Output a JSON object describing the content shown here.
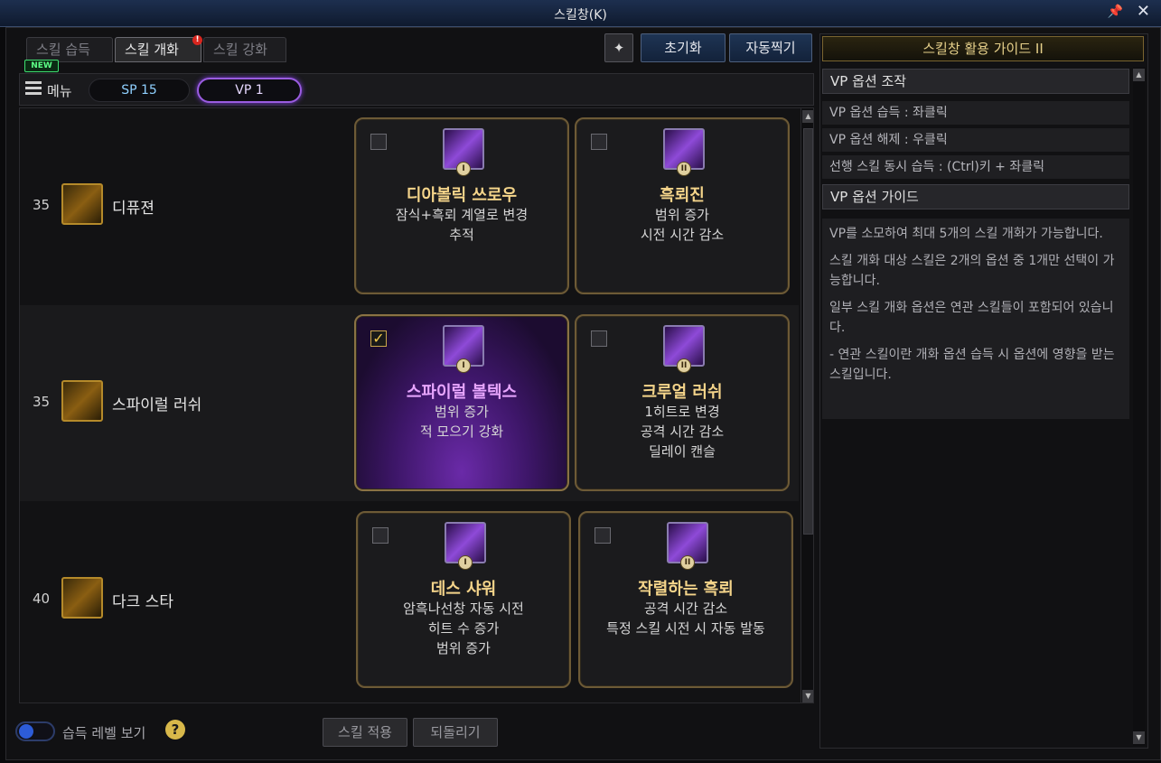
{
  "window": {
    "title": "스킬창(K)",
    "pin_icon": "pin-icon",
    "close_icon": "close-icon"
  },
  "tabs": [
    {
      "label": "스킬 습득",
      "active": false
    },
    {
      "label": "스킬 개화",
      "active": true
    },
    {
      "label": "스킬 강화",
      "active": false
    }
  ],
  "badges": {
    "alert": "!",
    "new": "NEW"
  },
  "toolbar": {
    "reset_label": "초기화",
    "auto_label": "자동찍기",
    "star_glyph": "✦"
  },
  "menubar": {
    "menu_label": "메뉴",
    "sp": "SP 15",
    "vp": "VP 1"
  },
  "skills": [
    {
      "level": "35",
      "name": "디퓨젼",
      "options": [
        {
          "roman": "I",
          "title": "디아볼릭 쓰로우",
          "desc": [
            "잠식+흑뢰 계열로 변경",
            "추적"
          ],
          "checked": false
        },
        {
          "roman": "II",
          "title": "흑뢰진",
          "desc": [
            "범위 증가",
            "시전 시간 감소"
          ],
          "checked": false
        }
      ]
    },
    {
      "level": "35",
      "name": "스파이럴 러쉬",
      "options": [
        {
          "roman": "I",
          "title": "스파이럴 볼텍스",
          "desc": [
            "범위 증가",
            "적 모으기 강화"
          ],
          "checked": true
        },
        {
          "roman": "II",
          "title": "크루얼 러쉬",
          "desc": [
            "1히트로 변경",
            "공격 시간 감소",
            "딜레이 캔슬"
          ],
          "checked": false
        }
      ]
    },
    {
      "level": "40",
      "name": "다크 스타",
      "options": [
        {
          "roman": "I",
          "title": "데스 샤워",
          "desc": [
            "암흑나선창 자동 시전",
            "히트 수 증가",
            "범위 증가"
          ],
          "checked": false
        },
        {
          "roman": "II",
          "title": "작렬하는 흑뢰",
          "desc": [
            "공격 시간 감소",
            "특정 스킬 시전 시 자동 발동"
          ],
          "checked": false
        }
      ]
    }
  ],
  "bottom": {
    "toggle_label": "습득 레벨 보기",
    "help": "?",
    "apply_label": "스킬 적용",
    "revert_label": "되돌리기"
  },
  "guide": {
    "title": "스킬창 활용 가이드 II",
    "control_head": "VP 옵션 조작",
    "controls": [
      "VP 옵션 습득 : 좌클릭",
      "VP 옵션 해제 : 우클릭",
      "선행 스킬 동시 습득 : (Ctrl)키 + 좌클릭"
    ],
    "guide_head": "VP 옵션 가이드",
    "paragraphs": [
      "VP를 소모하여 최대 5개의 스킬 개화가 가능합니다.",
      "스킬 개화 대상 스킬은 2개의 옵션 중 1개만 선택이 가능합니다.",
      "일부 스킬 개화 옵션은 연관 스킬들이 포함되어 있습니다.",
      "- 연관 스킬이란 개화 옵션 습득 시 옵션에 영향을 받는 스킬입니다."
    ]
  },
  "colors": {
    "accent_vp": "#9a5ce0",
    "gold": "#b58a2a",
    "sp_text": "#8fd0ff"
  }
}
